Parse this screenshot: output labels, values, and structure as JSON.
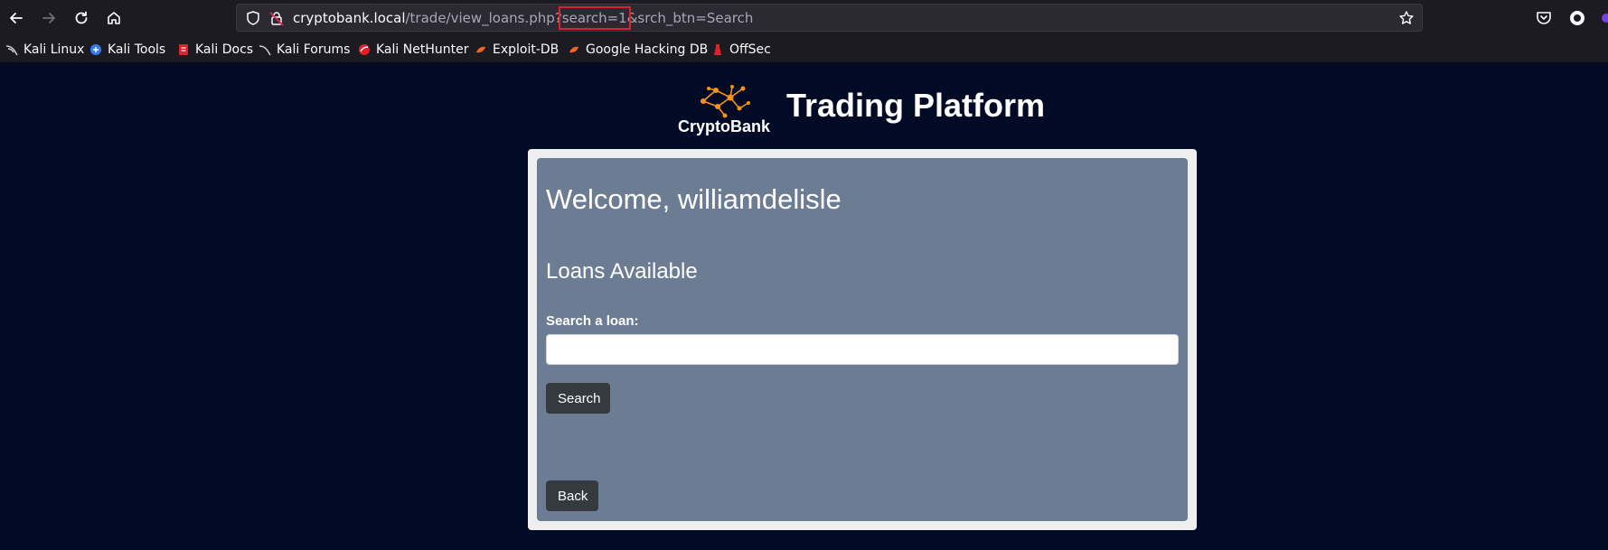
{
  "browser": {
    "url": {
      "host": "cryptobank.local",
      "path": "/trade/view_loans.php?",
      "highlighted_param": "search=1",
      "rest": "&srch_btn=Search"
    },
    "bookmarks": [
      {
        "label": "Kali Linux",
        "icon": "kali-dragon-icon"
      },
      {
        "label": "Kali Tools",
        "icon": "kali-tools-icon"
      },
      {
        "label": "Kali Docs",
        "icon": "kali-docs-icon"
      },
      {
        "label": "Kali Forums",
        "icon": "kali-forums-icon"
      },
      {
        "label": "Kali NetHunter",
        "icon": "nethunter-icon"
      },
      {
        "label": "Exploit-DB",
        "icon": "exploit-db-icon"
      },
      {
        "label": "Google Hacking DB",
        "icon": "ghdb-icon"
      },
      {
        "label": "OffSec",
        "icon": "offsec-icon"
      }
    ],
    "highlight_color": "#e0202a"
  },
  "page": {
    "logo_word": "CryptoBank",
    "title": "Trading Platform",
    "welcome": "Welcome, williamdelisle",
    "section_title": "Loans Available",
    "search": {
      "label": "Search a loan:",
      "value": "",
      "button_label": "Search"
    },
    "back_label": "Back",
    "colors": {
      "background": "#020b26",
      "card": "#6c7d93",
      "button": "#343a40",
      "logo_accent": "#f7931a"
    }
  }
}
